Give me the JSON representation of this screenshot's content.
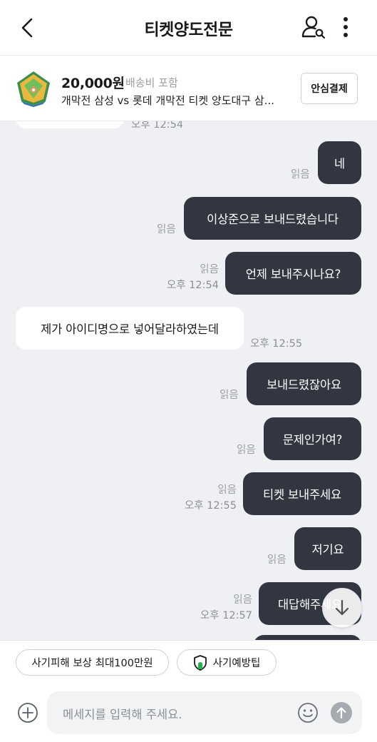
{
  "header": {
    "title": "티켓양도전문"
  },
  "product": {
    "price": "20,000원",
    "shipping": "배송비 포함",
    "name": "개막전 삼성 vs 롯데 개막전 티켓 양도대구 삼...",
    "safe_pay_label": "안심결제"
  },
  "chat": {
    "partial_top_time": "오후 12:54",
    "messages": [
      {
        "sender": "me",
        "text": "네",
        "read": "읽음",
        "time": ""
      },
      {
        "sender": "me",
        "text": "이상준으로 보내드렸습니다",
        "read": "읽음",
        "time": ""
      },
      {
        "sender": "me",
        "text": "언제 보내주시나요?",
        "read": "읽음",
        "time": "오후 12:54"
      },
      {
        "sender": "other",
        "text": "제가 아이디명으로 넣어달라하였는데",
        "read": "",
        "time": "오후 12:55"
      },
      {
        "sender": "me",
        "text": "보내드렸잖아요",
        "read": "읽음",
        "time": ""
      },
      {
        "sender": "me",
        "text": "문제인가여?",
        "read": "읽음",
        "time": ""
      },
      {
        "sender": "me",
        "text": "티켓 보내주세요",
        "read": "읽음",
        "time": "오후 12:55"
      },
      {
        "sender": "me",
        "text": "저기요",
        "read": "읽음",
        "time": ""
      },
      {
        "sender": "me",
        "text": "대답해주세요",
        "read": "읽음",
        "time": "오후 12:57"
      }
    ]
  },
  "chips": [
    {
      "label": "사기피해 보상 최대100만원",
      "icon": ""
    },
    {
      "label": "사기예방팁",
      "icon": "shield-icon"
    }
  ],
  "input": {
    "placeholder": "메세지를 입력해 주세요."
  },
  "colors": {
    "my_bubble": "#323640",
    "chat_background": "#eef0f4",
    "accent_green": "#1fb44f"
  }
}
